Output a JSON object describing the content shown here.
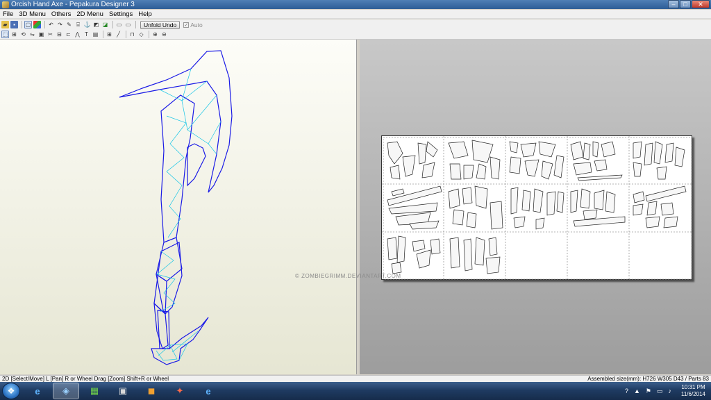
{
  "window": {
    "title": "Orcish Hand Axe - Pepakura Designer 3",
    "controls": {
      "minimize": "–",
      "maximize": "□",
      "close": "✕"
    }
  },
  "menu": [
    "File",
    "3D Menu",
    "Others",
    "2D Menu",
    "Settings",
    "Help"
  ],
  "toolbar": {
    "unfold_undo_label": "Unfold Undo",
    "auto_label": "Auto",
    "auto_checked": true,
    "row1_icons": [
      "open-icon",
      "save-icon",
      "separator",
      "view-icon",
      "texture-icon",
      "separator",
      "rotate-left-icon",
      "rotate-right-icon",
      "pencil-icon",
      "join-icon",
      "anchor-icon",
      "face-icon",
      "edge-icon",
      "separator",
      "window-icon",
      "window2-icon",
      "separator"
    ],
    "row2_icons": [
      "select-icon",
      "move-icon",
      "rotate-icon",
      "flip-icon",
      "rect-icon",
      "cut-icon",
      "glue-icon",
      "edge-tab-icon",
      "fold-icon",
      "text-icon",
      "image-icon",
      "separator",
      "grid-icon",
      "line-icon",
      "separator",
      "tab-icon",
      "shape-icon",
      "separator",
      "zoom-in-icon",
      "zoom-out-icon"
    ]
  },
  "status": {
    "left": "2D [Select/Move] L [Pan] R or Wheel Drag [Zoom] Shift+R or Wheel",
    "right": "Assembled size(mm): H726 W305 D43 / Parts 83"
  },
  "watermark": "© ZOMBIEGRIMM.DEVIANTART.COM",
  "colors": {
    "mesh_outline": "#1a1ae6",
    "mesh_fold": "#19c6e6",
    "titlebar": "#3a6aa3"
  },
  "taskbar": {
    "apps": [
      "internet-explorer-icon",
      "pepakura-icon",
      "minecraft-icon",
      "computer-icon",
      "files-icon",
      "pepakura-viewer-icon",
      "internet-explorer-2-icon"
    ],
    "time": "10:31 PM",
    "date": "11/6/2014"
  }
}
